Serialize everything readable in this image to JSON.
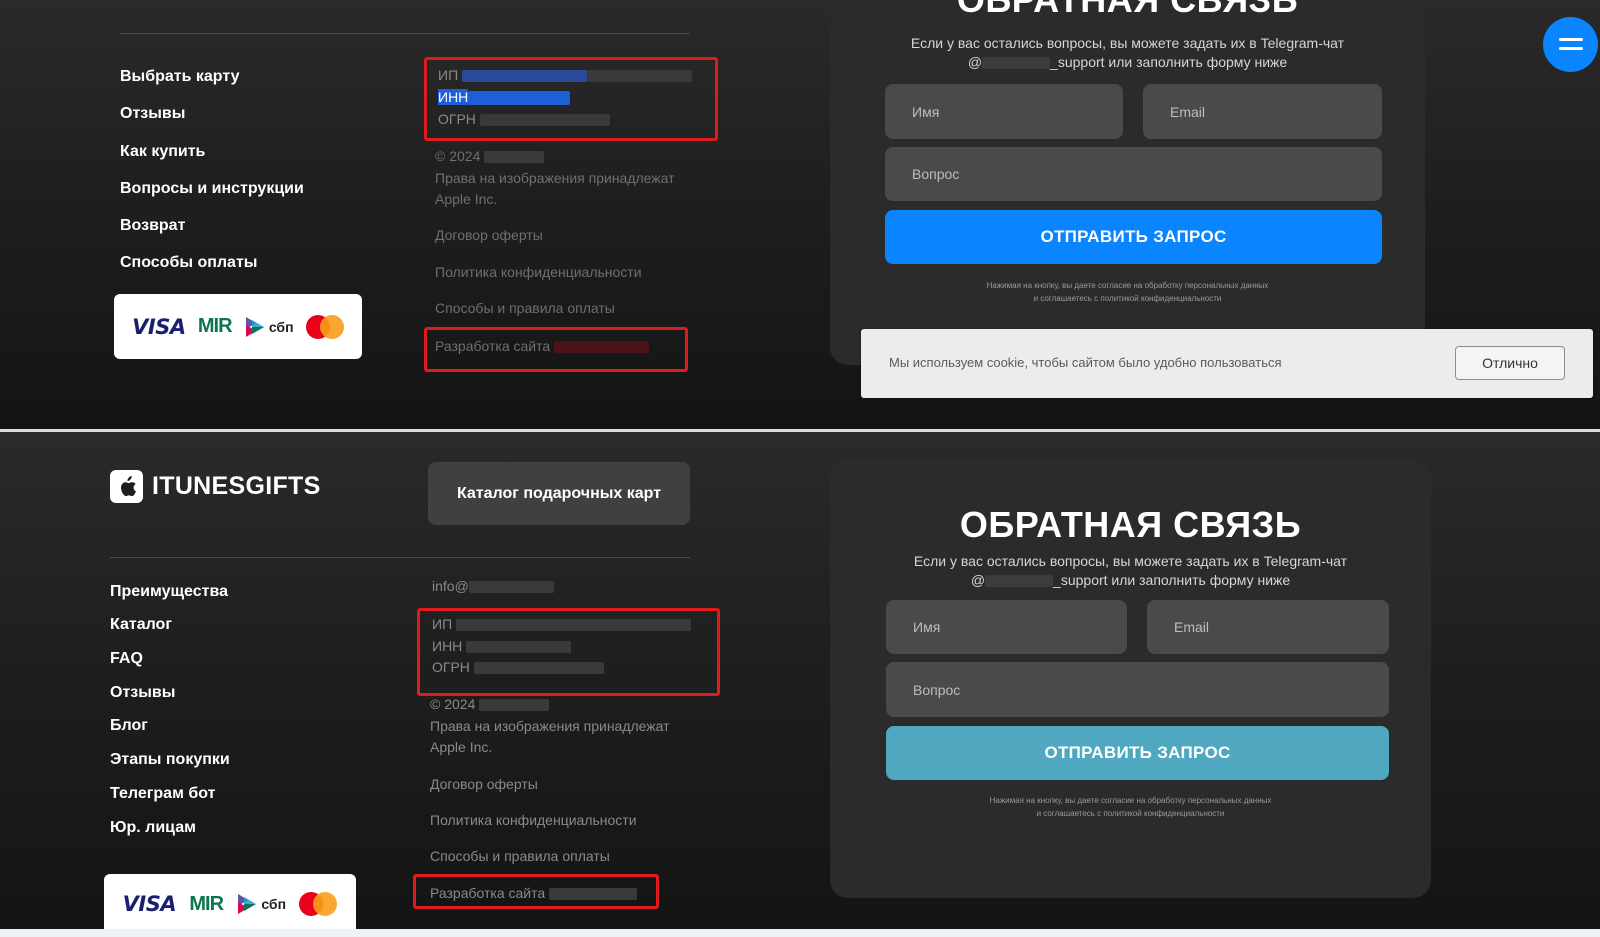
{
  "top": {
    "nav": [
      "Выбрать карту",
      "Отзывы",
      "Как купить",
      "Вопросы и инструкции",
      "Возврат",
      "Способы оплаты"
    ],
    "legal": {
      "ip": "ИП",
      "inn": "ИНН",
      "ogrn": "ОГРН"
    },
    "copyright": "© 2024",
    "rights": [
      "Права на изображения принадлежат",
      "Apple Inc."
    ],
    "links": [
      "Договор оферты",
      "Политика конфиденциальности",
      "Способы и правила оплаты"
    ],
    "dev": "Разработка сайта"
  },
  "bottom": {
    "logo": "ITUNESGIFTS",
    "catalog_button": "Каталог подарочных карт",
    "nav": [
      "Преимущества",
      "Каталог",
      "FAQ",
      "Отзывы",
      "Блог",
      "Этапы покупки",
      "Телеграм бот",
      "Юр. лицам"
    ],
    "email": "info@",
    "legal": {
      "ip": "ИП",
      "inn": "ИНН",
      "ogrn": "ОГРН"
    },
    "copyright": "© 2024",
    "rights": [
      "Права на изображения принадлежат",
      "Apple Inc."
    ],
    "links": [
      "Договор оферты",
      "Политика конфиденциальности",
      "Способы и правила оплаты"
    ],
    "dev": "Разработка сайта"
  },
  "payment": {
    "visa": "VISA",
    "mir": "MIR",
    "sbp": "сбп"
  },
  "feedback": {
    "title": "ОБРАТНАЯ СВЯЗЬ",
    "desc_line1": "Если у вас остались вопросы, вы можете задать их в Telegram-чат",
    "desc_at": "@",
    "desc_line2_suffix": "_support или заполнить форму ниже",
    "name_placeholder": "Имя",
    "email_placeholder": "Email",
    "question_placeholder": "Вопрос",
    "submit": "ОТПРАВИТЬ ЗАПРОС",
    "consent_line1": "Нажимая на кнопку, вы даете согласие на обработку персональных данных",
    "consent_line2": "и соглашаетесь с политикой конфиденциальности"
  },
  "cookie": {
    "text": "Мы используем cookie, чтобы сайтом было удобно пользоваться",
    "button": "Отлично"
  },
  "colors": {
    "submit_top": "#0a84ff",
    "submit_bottom": "#4fa8bf",
    "highlight": "#e01b1b",
    "fab": "#0a84ff"
  },
  "icons": {
    "fab": "menu-icon",
    "logo": "apple-icon",
    "sbp": "sbp-logo-icon",
    "mastercard": "mastercard-logo-icon"
  }
}
